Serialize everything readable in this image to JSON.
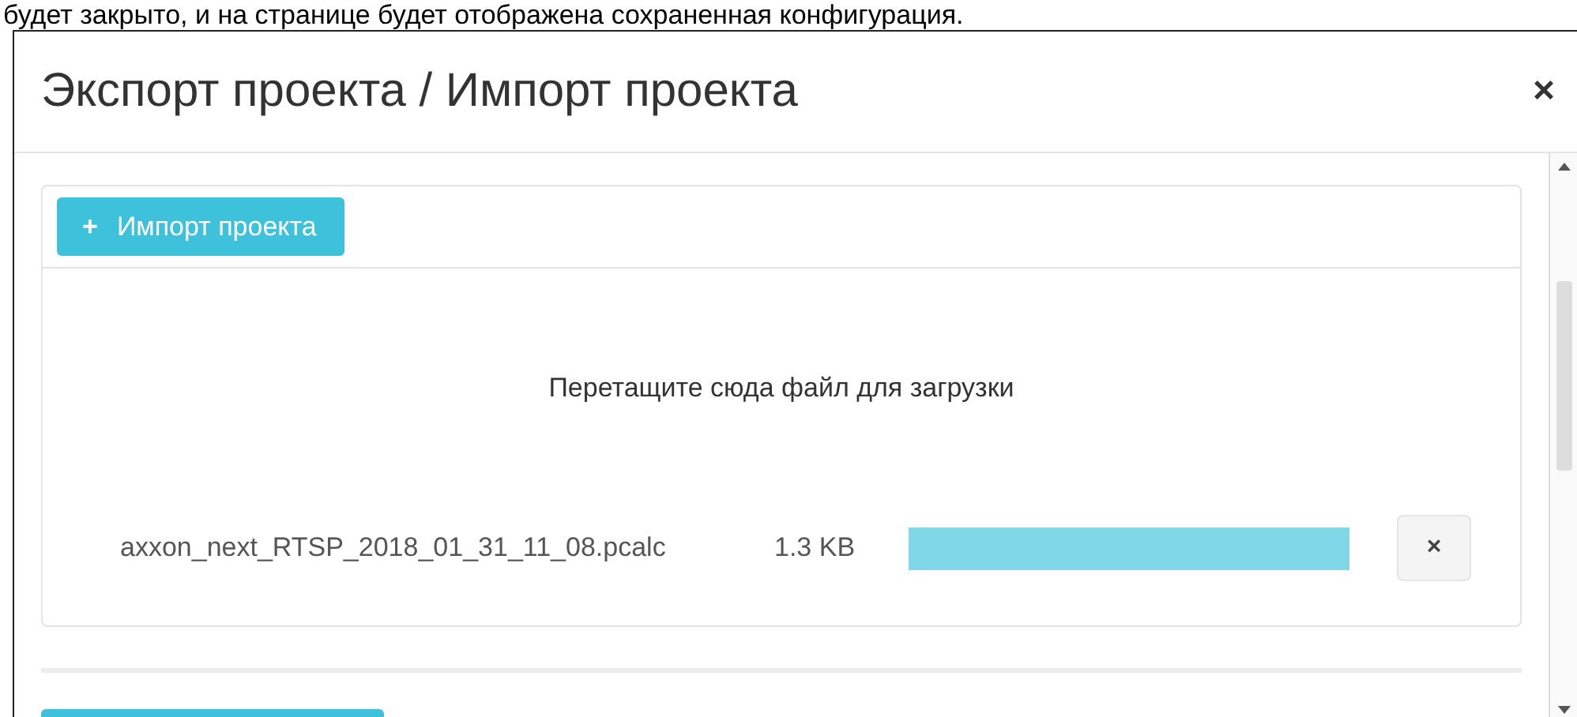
{
  "page_text": "будет закрыто, и на странице будет отображена сохраненная конфигурация.",
  "dialog": {
    "title": "Экспорт проекта / Импорт проекта",
    "close": "×",
    "import_button": {
      "icon": "+",
      "label": "Импорт проекта"
    },
    "drop_hint": "Перетащите сюда файл для загрузки",
    "files": [
      {
        "name": "axxon_next_RTSP_2018_01_31_11_08.pcalc",
        "size": "1.3 KB",
        "level": 1,
        "remove": "×"
      }
    ]
  }
}
